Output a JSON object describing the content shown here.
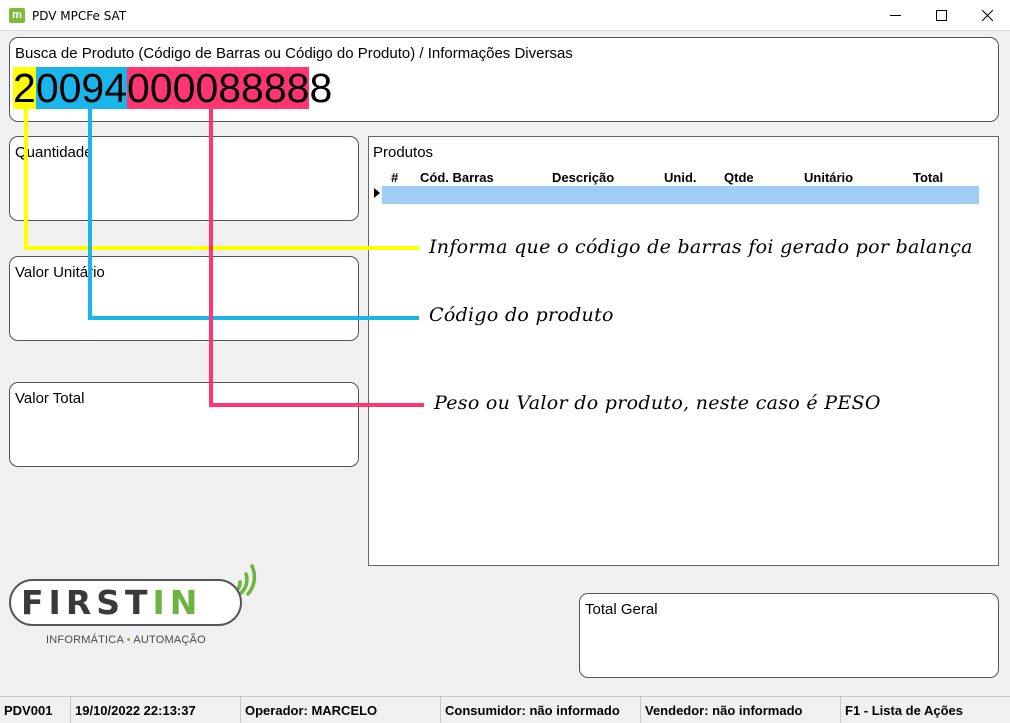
{
  "window": {
    "icon_letter": "m",
    "title": "PDV MPCFe SAT"
  },
  "search": {
    "label": "Busca de Produto (Código de Barras ou Código do Produto) / Informações Diversas",
    "barcode_segments": [
      "2",
      "0094",
      "00008888",
      "8"
    ]
  },
  "panels": {
    "quantidade": "Quantidade",
    "valor_unitario": "Valor Unitário",
    "valor_total": "Valor Total",
    "total_geral": "Total Geral"
  },
  "products": {
    "title": "Produtos",
    "columns": [
      "#",
      "Cód. Barras",
      "Descrição",
      "Unid.",
      "Qtde",
      "Unitário",
      "Total"
    ]
  },
  "annotations": {
    "scale": "Informa que o código de barras foi gerado por balança",
    "product_code": "Código do produto",
    "weight_value": "Peso ou Valor do produto, neste caso é PESO"
  },
  "logo": {
    "text_main": "FIRST",
    "text_accent": "IN",
    "sub_left": "INFORMÁTICA",
    "sub_sep": "•",
    "sub_right": "AUTOMAÇÃO"
  },
  "status": {
    "pdv": "PDV001",
    "datetime": "19/10/2022 22:13:37",
    "operador": "Operador: MARCELO",
    "consumidor": "Consumidor: não informado",
    "vendedor": "Vendedor: não informado",
    "help": "F1 - Lista de Ações"
  },
  "colors": {
    "scale_flag": "#ffff00",
    "product_code": "#1ab6ea",
    "weight": "#ff3574",
    "brand_green": "#6cb33f"
  }
}
